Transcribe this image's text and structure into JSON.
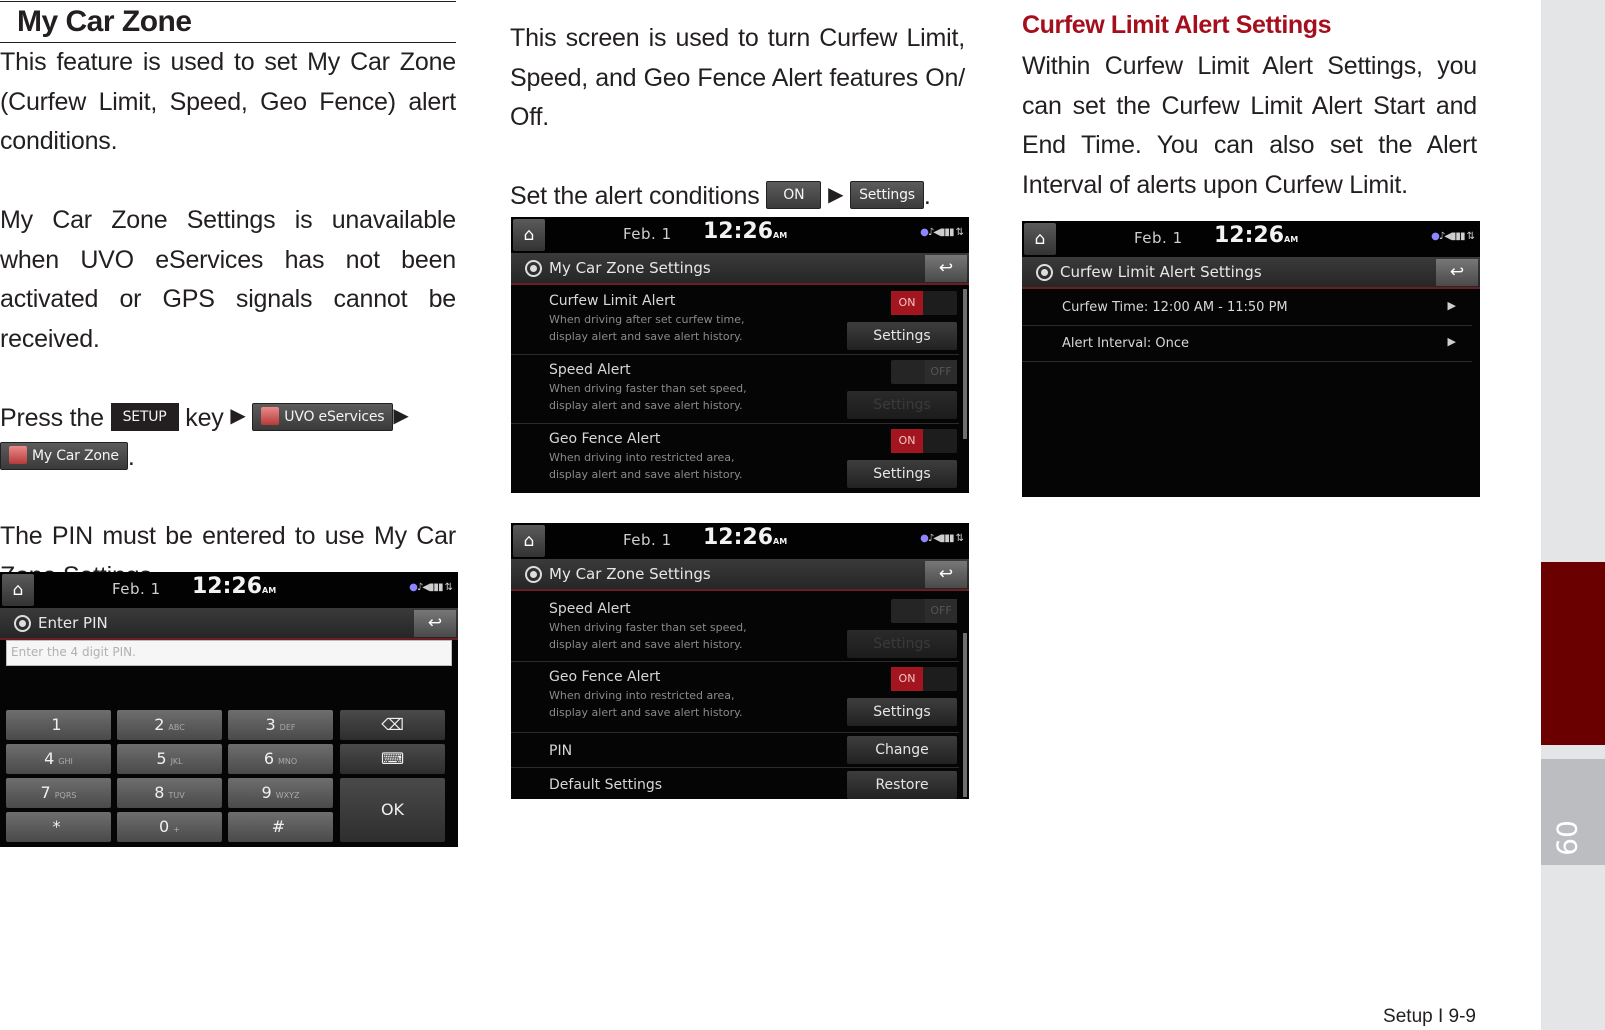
{
  "col1": {
    "title": "My Car Zone",
    "intro": "This feature is used to set My Car Zone (Curfew Limit, Speed, Geo Fence) alert conditions.",
    "unavailable": "My Car Zone Settings is unavailable when UVO eServices has not been activated or GPS signals cannot be received.",
    "press_prefix": "Press the",
    "setup_key": "SETUP",
    "key_word": "key",
    "uvo_button": "UVO eServices",
    "mycarzone_button": "My Car Zone",
    "period": ".",
    "pin_note": "The PIN must be entered to use My Car Zone Settings.",
    "arrow": "▶"
  },
  "col2": {
    "intro": "This screen is used to turn Curfew Limit, Speed, and Geo Fence Alert features On/ Off.",
    "set_prefix": "Set the alert conditions",
    "on_button": "ON",
    "settings_button": "Settings",
    "period": ".",
    "arrow": "▶"
  },
  "col3": {
    "subtitle": "Curfew Limit Alert Settings",
    "body": "Within Curfew Limit Alert Settings, you can set the Curfew Limit Alert Start and End Time. You can also set the Alert Interval of alerts upon Curfew Limit."
  },
  "status": {
    "date": "Feb.   1",
    "time": "12:26",
    "ampm": "AM",
    "icons": "●♪◀▮▮▮ ⇅"
  },
  "pin_screen": {
    "title": "Enter PIN",
    "placeholder": "Enter the 4 digit PIN.",
    "keys": [
      {
        "num": "1",
        "letters": ""
      },
      {
        "num": "2",
        "letters": "ABC"
      },
      {
        "num": "3",
        "letters": "DEF"
      },
      {
        "num": "4",
        "letters": "GHI"
      },
      {
        "num": "5",
        "letters": "JKL"
      },
      {
        "num": "6",
        "letters": "MNO"
      },
      {
        "num": "7",
        "letters": "PQRS"
      },
      {
        "num": "8",
        "letters": "TUV"
      },
      {
        "num": "9",
        "letters": "WXYZ"
      },
      {
        "num": "*",
        "letters": ""
      },
      {
        "num": "0",
        "letters": "+"
      },
      {
        "num": "#",
        "letters": ""
      }
    ],
    "ok_label": "OK",
    "backspace": "⌫",
    "keyboard_hide": "⌨"
  },
  "settings_screen": {
    "title": "My Car Zone Settings",
    "curfew": {
      "title": "Curfew Limit Alert",
      "desc1": "When driving after set curfew time,",
      "desc2": "display alert and save alert history.",
      "toggle": "ON",
      "button": "Settings"
    },
    "speed": {
      "title": "Speed Alert",
      "desc1": "When driving faster than set speed,",
      "desc2": "display alert and save alert history.",
      "toggle": "OFF",
      "button": "Settings"
    },
    "geo": {
      "title": "Geo Fence Alert",
      "desc1": "When driving into restricted area,",
      "desc2": "display alert and save alert history.",
      "toggle": "ON",
      "button": "Settings"
    },
    "pin": {
      "title": "PIN",
      "button": "Change"
    },
    "default": {
      "title": "Default Settings",
      "button": "Restore"
    }
  },
  "curfew_screen": {
    "title": "Curfew Limit Alert Settings",
    "rows": [
      {
        "label": "Curfew Time: 12:00 AM - 11:50 PM"
      },
      {
        "label": "Alert Interval: Once"
      }
    ],
    "chevron": "▶"
  },
  "sidebar": {
    "chapter": "09"
  },
  "footer": {
    "page": "Setup I 9-9"
  },
  "colors": {
    "accent_red": "#a50e1c",
    "tab_red": "#6b0000",
    "toggle_on": "#a4161f"
  }
}
